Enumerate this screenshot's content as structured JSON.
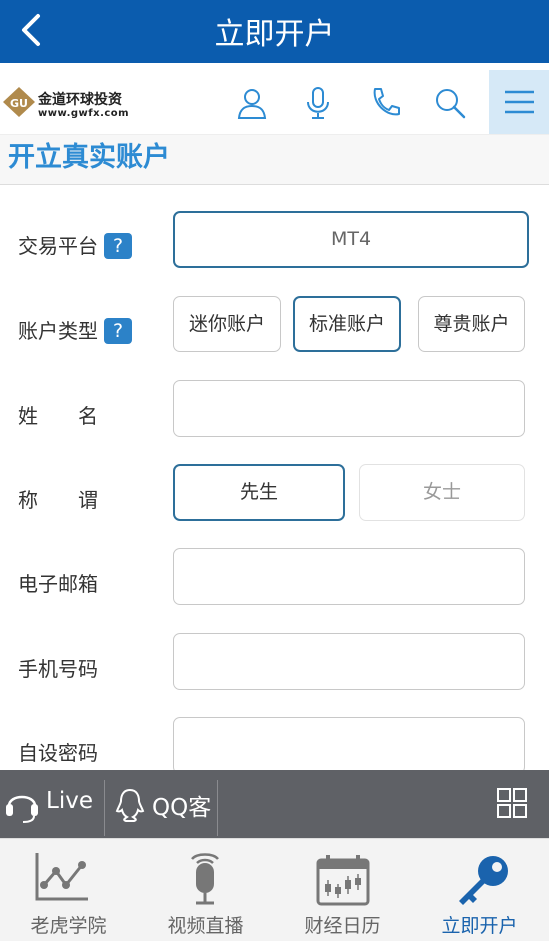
{
  "topbar": {
    "title": "立即开户"
  },
  "header": {
    "brand_name": "金道环球投资",
    "brand_url": "www.gwfx.com",
    "icons": [
      "user-icon",
      "microphone-icon",
      "phone-icon",
      "search-icon",
      "menu-icon"
    ]
  },
  "section_title": "开立真实账户",
  "form": {
    "platform": {
      "label": "交易平台",
      "help": "?",
      "value": "MT4"
    },
    "account_type": {
      "label": "账户类型",
      "help": "?",
      "options": [
        "迷你账户",
        "标准账户",
        "尊贵账户"
      ],
      "selected": "标准账户"
    },
    "name": {
      "label": "姓　　名",
      "value": ""
    },
    "title": {
      "label": "称　　谓",
      "options": [
        "先生",
        "女士"
      ],
      "selected": "先生"
    },
    "email": {
      "label": "电子邮箱",
      "value": ""
    },
    "mobile": {
      "label": "手机号码",
      "value": ""
    },
    "password": {
      "label": "自设密码",
      "value": ""
    }
  },
  "livebar": {
    "live": "Live",
    "qq": "QQ客"
  },
  "tabs": [
    {
      "label": "老虎学院",
      "icon": "chart-icon"
    },
    {
      "label": "视频直播",
      "icon": "microphone-icon"
    },
    {
      "label": "财经日历",
      "icon": "calendar-icon"
    },
    {
      "label": "立即开户",
      "icon": "key-icon",
      "active": true
    }
  ],
  "colors": {
    "primary": "#0b5cae",
    "accent": "#2d8bd3",
    "livebar": "#5f6166"
  }
}
